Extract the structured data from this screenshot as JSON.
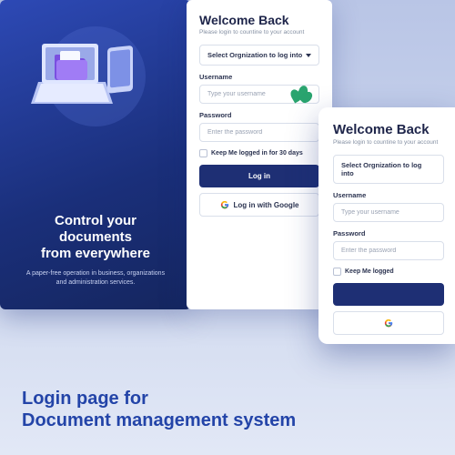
{
  "hero": {
    "title_l1": "Control your documents",
    "title_l2": "from everywhere",
    "subtitle": "A paper-free operation in business, organizations and administration services."
  },
  "form": {
    "heading": "Welcome Back",
    "subtitle": "Please login to countine to your account",
    "org_select": "Select Orgnization to log into",
    "username_label": "Username",
    "username_ph": "Type your username",
    "password_label": "Password",
    "password_ph": "Enter the password",
    "remember": "Keep Me logged in for 30 days",
    "remember_short": "Keep Me logged",
    "login_btn": "Log in",
    "google_btn": "Log in with Google"
  },
  "footer": {
    "l1": "Login page for",
    "l2": "Document management system"
  },
  "colors": {
    "primary": "#1e2f74",
    "brand_gradient_a": "#2d49b5",
    "brand_gradient_b": "#15265f"
  },
  "icons": {
    "chevron": "chevron-down-icon",
    "google": "google-icon"
  }
}
